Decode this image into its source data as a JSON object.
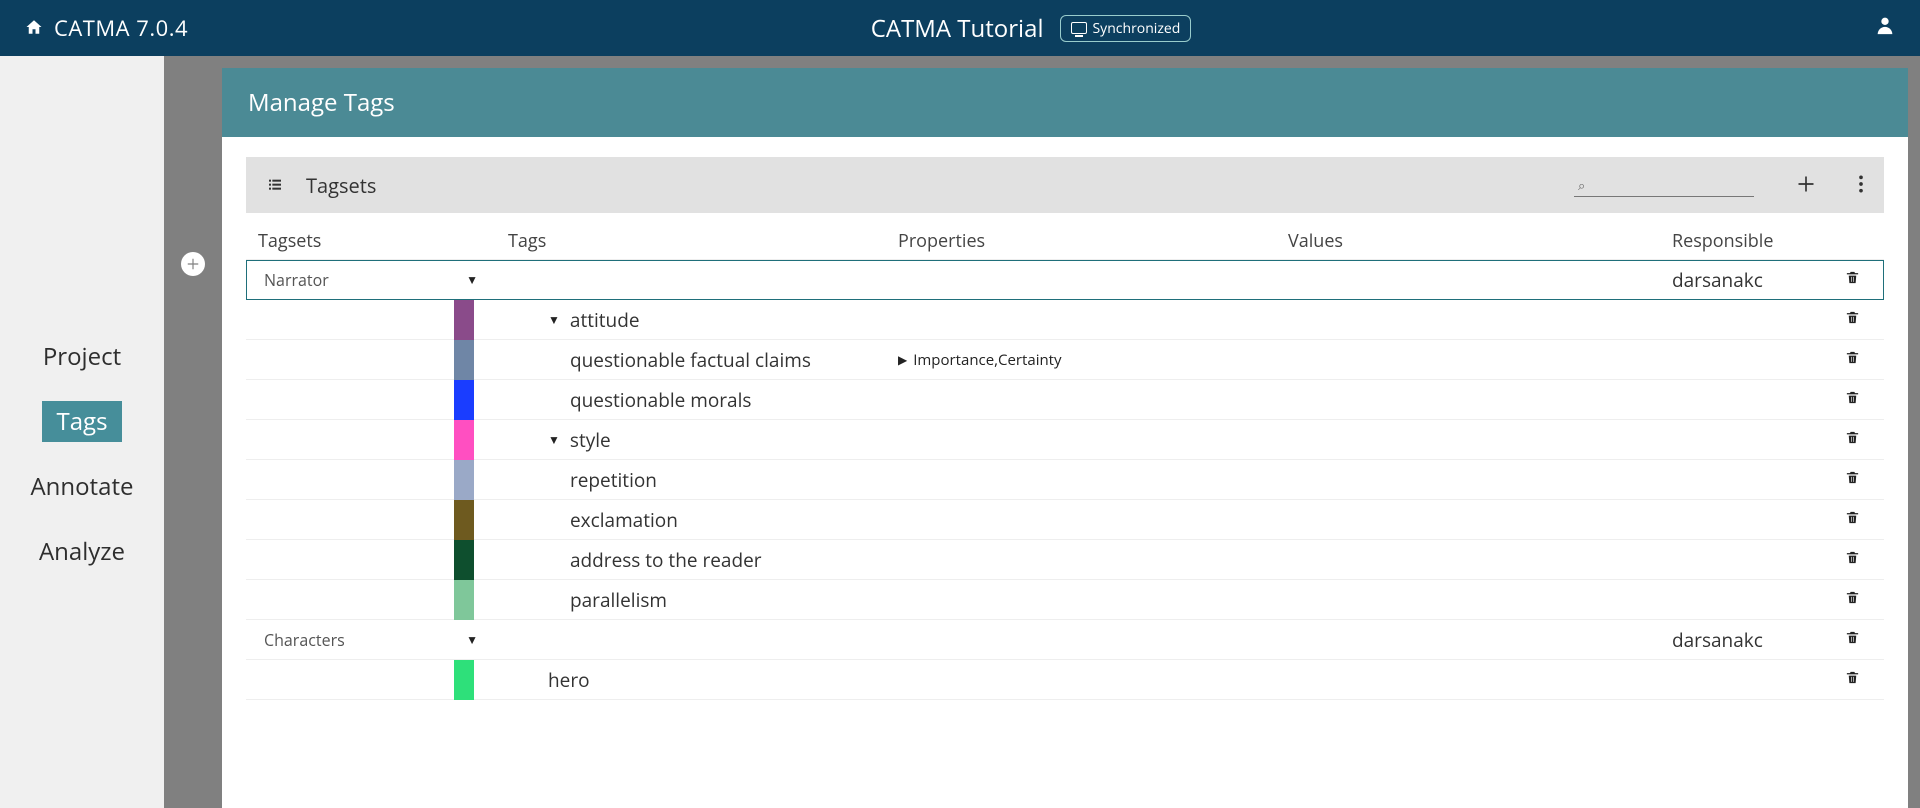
{
  "header": {
    "app_title": "CATMA 7.0.4",
    "tutorial_title": "CATMA Tutorial",
    "sync_badge": "Synchronized"
  },
  "nav": {
    "items": [
      "Project",
      "Tags",
      "Annotate",
      "Analyze"
    ],
    "active_index": 1
  },
  "panel": {
    "title": "Manage Tags",
    "tagsets_label": "Tagsets",
    "search_placeholder": ""
  },
  "columns": {
    "tagsets": "Tagsets",
    "tags": "Tags",
    "properties": "Properties",
    "values": "Values",
    "responsible": "Responsible"
  },
  "rows": [
    {
      "type": "tagset",
      "name": "Narrator",
      "responsible": "darsanakc",
      "selected": true
    },
    {
      "type": "tag",
      "indent": 1,
      "swatch": "#8a4b8a",
      "expand": "down",
      "label": "attitude"
    },
    {
      "type": "tag",
      "indent": 2,
      "swatch": "#6f86a6",
      "label": "questionable factual claims",
      "props_expand": "right",
      "properties": "Importance,Certainty"
    },
    {
      "type": "tag",
      "indent": 2,
      "swatch": "#1a3dff",
      "label": "questionable morals"
    },
    {
      "type": "tag",
      "indent": 1,
      "swatch": "#ff4fc1",
      "expand": "down",
      "label": "style"
    },
    {
      "type": "tag",
      "indent": 2,
      "swatch": "#9aa9c7",
      "label": "repetition"
    },
    {
      "type": "tag",
      "indent": 2,
      "swatch": "#6e5a1f",
      "label": "exclamation"
    },
    {
      "type": "tag",
      "indent": 2,
      "swatch": "#0e4f2e",
      "label": "address to the reader"
    },
    {
      "type": "tag",
      "indent": 2,
      "swatch": "#7fc79a",
      "label": "parallelism"
    },
    {
      "type": "tagset",
      "name": "Characters",
      "responsible": "darsanakc"
    },
    {
      "type": "tag",
      "indent": 1,
      "swatch": "#2ee07a",
      "label": "hero"
    }
  ]
}
